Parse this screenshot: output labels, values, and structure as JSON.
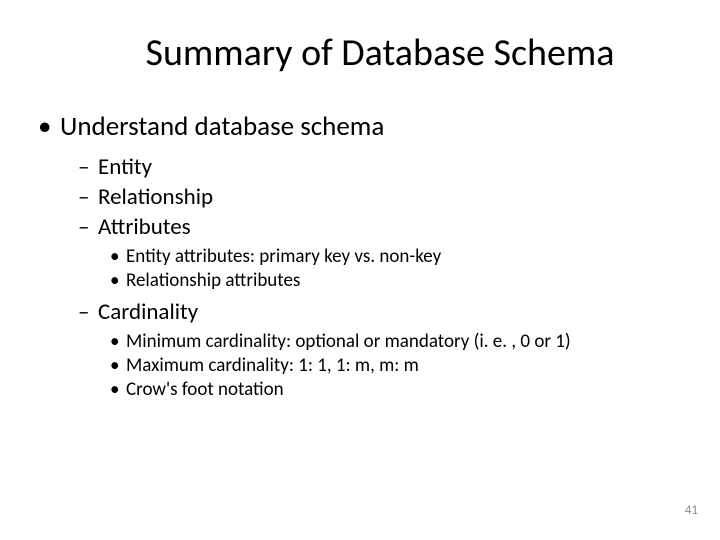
{
  "title": "Summary of Database Schema",
  "lvl1": {
    "item0": "Understand database schema"
  },
  "lvl2": {
    "item0": "Entity",
    "item1": "Relationship",
    "item2": "Attributes",
    "item3": "Cardinality"
  },
  "lvl3a": {
    "item0": "Entity attributes: primary key vs. non-key",
    "item1": "Relationship attributes"
  },
  "lvl3b": {
    "item0": "Minimum cardinality: optional or mandatory (i. e. , 0 or 1)",
    "item1": "Maximum cardinality: 1: 1, 1: m, m: m",
    "item2": "Crow's foot notation"
  },
  "pagenum": "41"
}
